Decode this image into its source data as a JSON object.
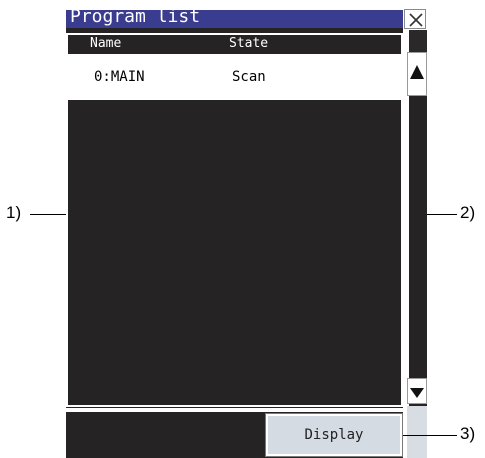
{
  "window": {
    "title": "Program list",
    "close_icon": "close-icon"
  },
  "table": {
    "columns": [
      "Name",
      "State"
    ],
    "rows": [
      {
        "name": "0:MAIN",
        "state": "Scan"
      }
    ]
  },
  "scrollbar": {
    "up_icon": "triangle-up-icon",
    "down_icon": "triangle-down-icon"
  },
  "footer": {
    "display_label": "Display"
  },
  "callouts": {
    "c1": "1)",
    "c2": "2)",
    "c3": "3)"
  },
  "colors": {
    "title_bar": "#3a3c8f",
    "panel_bg": "#262324",
    "button_bg": "#d4dbe2"
  }
}
